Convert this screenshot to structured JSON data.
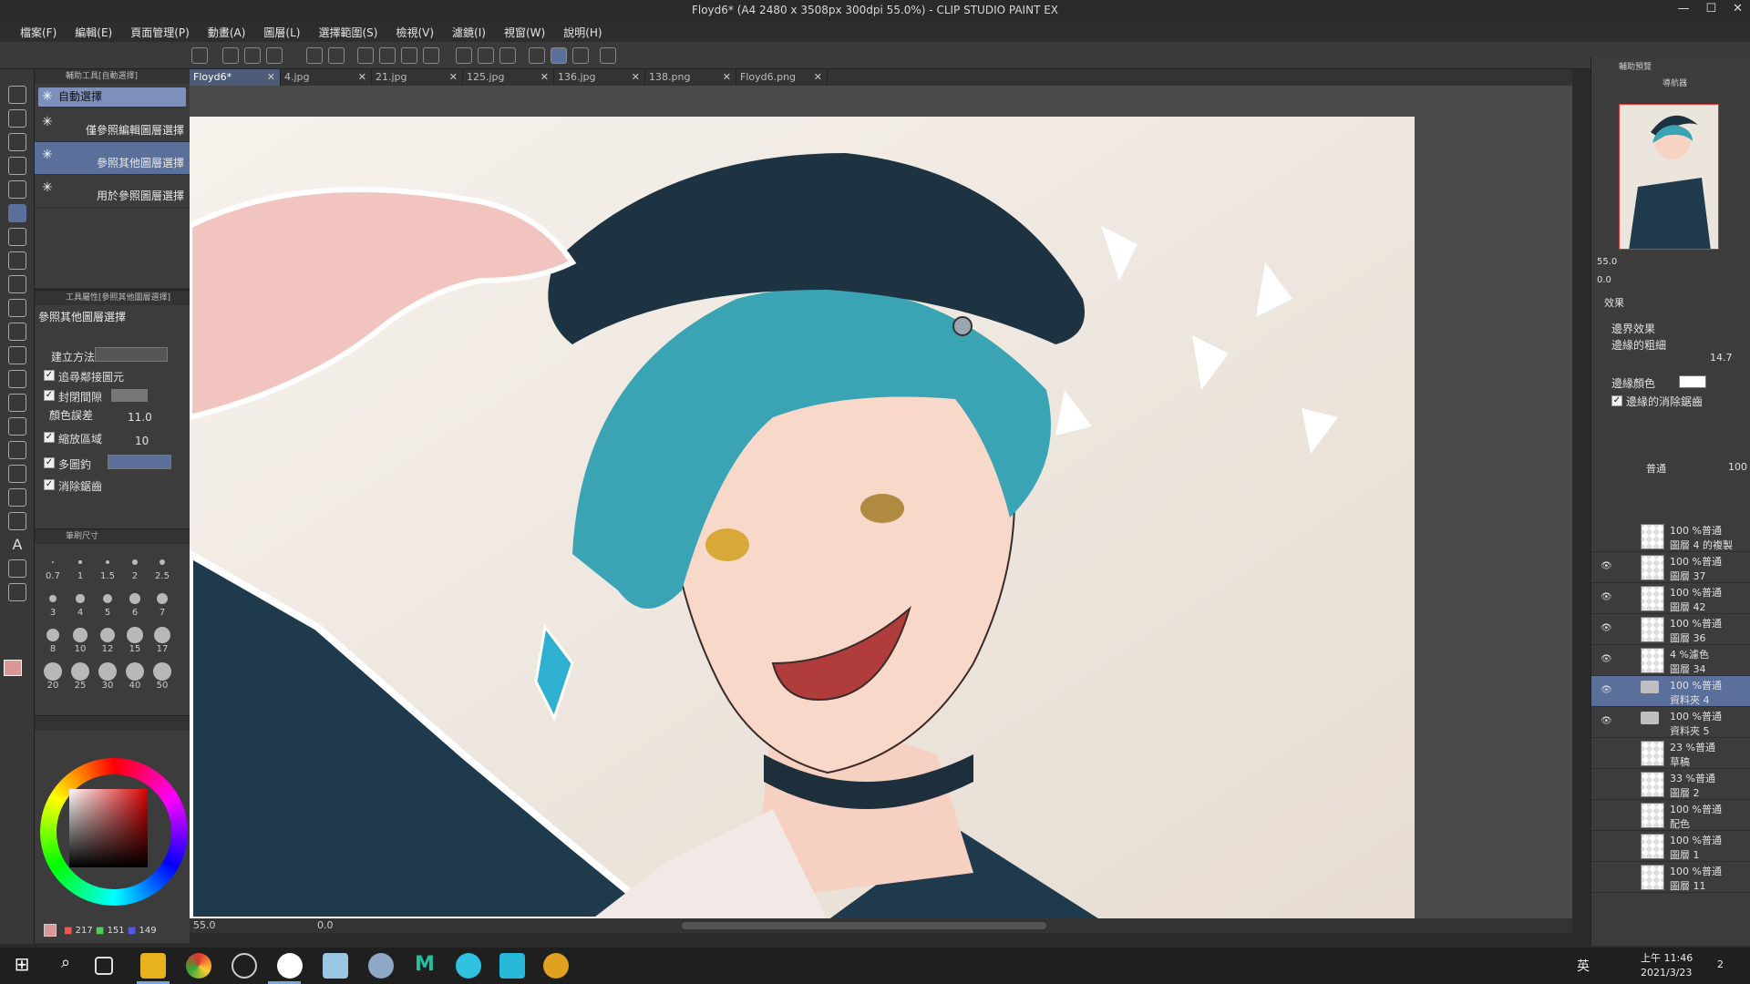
{
  "window": {
    "title": "Floyd6* (A4 2480 x 3508px 300dpi 55.0%) - CLIP STUDIO PAINT EX"
  },
  "menu": [
    "檔案(F)",
    "編輯(E)",
    "頁面管理(P)",
    "動畫(A)",
    "圖層(L)",
    "選擇範圍(S)",
    "檢視(V)",
    "濾鏡(I)",
    "視窗(W)",
    "說明(H)"
  ],
  "subtool": {
    "header": "輔助工具[自動選擇]",
    "items": [
      "自動選擇",
      "僅參照編輯圖層選擇",
      "參照其他圖層選擇",
      "用於參照圖層選擇"
    ]
  },
  "toolprop": {
    "header": "工具屬性[參照其他圖層選擇]",
    "title": "參照其他圖層選擇",
    "method_label": "建立方法",
    "follow_label": "追尋鄰接圖元",
    "close_gap_label": "封閉間隙",
    "color_margin_label": "顏色誤差",
    "color_margin_value": "11.0",
    "area_scaling_label": "縮放區域",
    "area_scaling_value": "10",
    "multi_ref_label": "多圖釣",
    "antialias_label": "消除鋸齒"
  },
  "brushsize": {
    "header": "筆刷尺寸",
    "sizes": [
      "0.7",
      "1",
      "1.5",
      "2",
      "2.5",
      "3",
      "4",
      "5",
      "6",
      "7",
      "8",
      "10",
      "12",
      "15",
      "17",
      "20",
      "25",
      "30",
      "40",
      "50"
    ]
  },
  "color": {
    "r": "217",
    "g": "151",
    "b": "149",
    "main_color": "#d99795",
    "sub_color": "#ffffff"
  },
  "tabs": [
    {
      "label": "Floyd6*",
      "active": true
    },
    {
      "label": "4.jpg"
    },
    {
      "label": "21.jpg"
    },
    {
      "label": "125.jpg"
    },
    {
      "label": "136.jpg"
    },
    {
      "label": "138.png"
    },
    {
      "label": "Floyd6.png"
    }
  ],
  "status": {
    "zoom": "55.0",
    "angle": "0.0"
  },
  "navigator": {
    "header": "輔助預覽",
    "title": "導航器",
    "zoom": "55.0",
    "rotation": "0.0"
  },
  "effect": {
    "title": "效果",
    "border_label": "邊界效果",
    "thickness_label": "邊緣的粗細",
    "thickness_value": "14.7",
    "color_label": "邊緣顏色",
    "antialias_label": "邊緣的消除鋸齒"
  },
  "layer_panel": {
    "blend": "普通",
    "opacity": "100"
  },
  "layers": [
    {
      "l1": "100 %普通",
      "l2": "圖層 4 的複製",
      "visible": false
    },
    {
      "l1": "100 %普通",
      "l2": "圖層 37",
      "visible": true
    },
    {
      "l1": "100 %普通",
      "l2": "圖層 42",
      "visible": true
    },
    {
      "l1": "100 %普通",
      "l2": "圖層 36",
      "visible": true
    },
    {
      "l1": "4 %濾色",
      "l2": "圖層 34",
      "visible": true
    },
    {
      "l1": "100 %普通",
      "l2": "資料夾 4",
      "visible": true,
      "folder": true,
      "selected": true
    },
    {
      "l1": "100 %普通",
      "l2": "資料夾 5",
      "visible": true,
      "folder": true
    },
    {
      "l1": "23 %普通",
      "l2": "草稿",
      "visible": false
    },
    {
      "l1": "33 %普通",
      "l2": "圖層 2",
      "visible": false
    },
    {
      "l1": "100 %普通",
      "l2": "配色",
      "visible": false
    },
    {
      "l1": "100 %普通",
      "l2": "圖層 1",
      "visible": false
    },
    {
      "l1": "100 %普通",
      "l2": "圖層 11",
      "visible": false
    }
  ],
  "taskbar": {
    "time": "上午 11:46",
    "date": "2021/3/23",
    "ime": "英",
    "notifications": "2"
  }
}
